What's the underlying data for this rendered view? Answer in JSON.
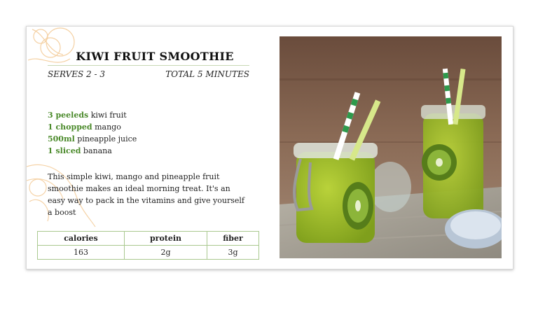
{
  "recipe": {
    "title": "KIWI FRUIT SMOOTHIE",
    "serves": "SERVES 2 - 3",
    "total_time": "TOTAL 5 MINUTES",
    "ingredients": [
      {
        "qty": "3 peeleds",
        "name": "kiwi fruit"
      },
      {
        "qty": "1 chopped",
        "name": "mango"
      },
      {
        "qty": "500ml",
        "name": "pineapple juice"
      },
      {
        "qty": "1 sliced",
        "name": "banana"
      }
    ],
    "description": "This simple kiwi, mango and pineapple fruit smoothie makes an ideal morning treat. It's an easy way to pack in the vitamins and give yourself a boost",
    "nutrition": {
      "headers": [
        "calories",
        "protein",
        "fiber"
      ],
      "values": [
        "163",
        "2g",
        "3g"
      ]
    }
  },
  "colors": {
    "accent_green": "#4b8a2b",
    "table_border": "#a9c98f",
    "decor_orange": "#f2c58c"
  },
  "image": {
    "icon": "smoothie-photo"
  }
}
